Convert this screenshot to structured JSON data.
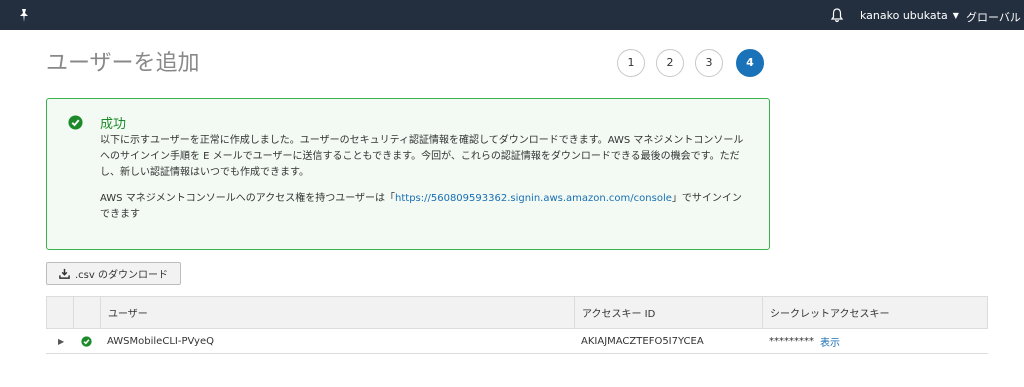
{
  "topbar": {
    "user": "kanako ubukata",
    "region": "グローバル"
  },
  "page": {
    "title": "ユーザーを追加"
  },
  "steps": [
    {
      "label": "1",
      "active": false
    },
    {
      "label": "2",
      "active": false
    },
    {
      "label": "3",
      "active": false
    },
    {
      "label": "4",
      "active": true
    }
  ],
  "success": {
    "title": "成功",
    "message": "以下に示すユーザーを正常に作成しました。ユーザーのセキュリティ認証情報を確認してダウンロードできます。AWS マネジメントコンソールへのサインイン手順を E メールでユーザーに送信することもできます。今回が、これらの認証情報をダウンロードできる最後の機会です。ただし、新しい認証情報はいつでも作成できます。",
    "console_prefix": "AWS マネジメントコンソールへのアクセス権を持つユーザーは「",
    "console_url": "https://560809593362.signin.aws.amazon.com/console",
    "console_suffix": "」でサインインできます"
  },
  "download_button": ".csv のダウンロード",
  "table": {
    "columns": [
      "ユーザー",
      "アクセスキー ID",
      "シークレットアクセスキー"
    ],
    "rows": [
      {
        "user": "AWSMobileCLI-PVyeQ",
        "access_key_id": "AKIAJMACZTEFO5I7YCEA",
        "secret_mask": "*********",
        "show_label": "表示"
      }
    ]
  },
  "colors": {
    "topbar": "#232f3e",
    "success_border": "#3cb24a",
    "success_bg": "#f2faf3",
    "success_text": "#1d8a2a",
    "link": "#1a6fb5",
    "active_step": "#1a73b8"
  }
}
